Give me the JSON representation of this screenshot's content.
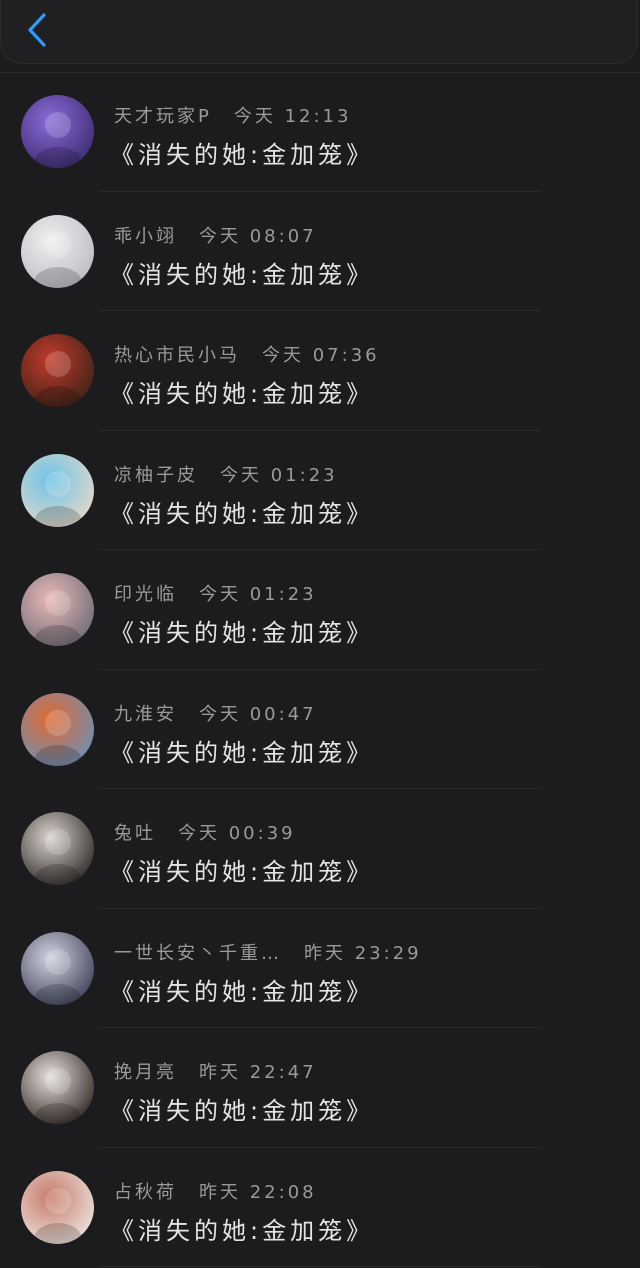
{
  "header": {
    "back_icon": "chevron-left-icon",
    "accent": "#2f9bff"
  },
  "messages": [
    {
      "username": "天才玩家P",
      "time": "今天 12:13",
      "text": "《消失的她:金加笼》",
      "avatar_colors": [
        "#8b6bd8",
        "#3b2a6e"
      ]
    },
    {
      "username": "乖小翊",
      "time": "今天 08:07",
      "text": "《消失的她:金加笼》",
      "avatar_colors": [
        "#f0f0f0",
        "#b9b9c2"
      ]
    },
    {
      "username": "热心市民小马",
      "time": "今天 07:36",
      "text": "《消失的她:金加笼》",
      "avatar_colors": [
        "#c23a2a",
        "#3a2218"
      ]
    },
    {
      "username": "凉柚子皮",
      "time": "今天 01:23",
      "text": "《消失的她:金加笼》",
      "avatar_colors": [
        "#6ec3e6",
        "#e7d9c9"
      ]
    },
    {
      "username": "印光临",
      "time": "今天 01:23",
      "text": "《消失的她:金加笼》",
      "avatar_colors": [
        "#e8b9b4",
        "#6c6a78"
      ]
    },
    {
      "username": "九淮安",
      "time": "今天 00:47",
      "text": "《消失的她:金加笼》",
      "avatar_colors": [
        "#e06a32",
        "#6b8fb8"
      ]
    },
    {
      "username": "兔吐",
      "time": "今天 00:39",
      "text": "《消失的她:金加笼》",
      "avatar_colors": [
        "#d9d2cc",
        "#2a2624"
      ]
    },
    {
      "username": "一世长安丶千重…",
      "time": "昨天 23:29",
      "text": "《消失的她:金加笼》",
      "avatar_colors": [
        "#cfd3de",
        "#3b3e55"
      ]
    },
    {
      "username": "挽月亮",
      "time": "昨天 22:47",
      "text": "《消失的她:金加笼》",
      "avatar_colors": [
        "#e6e0dc",
        "#2e2522"
      ]
    },
    {
      "username": "占秋荷",
      "time": "昨天 22:08",
      "text": "《消失的她:金加笼》",
      "avatar_colors": [
        "#c87b6a",
        "#ece6e2"
      ]
    }
  ]
}
